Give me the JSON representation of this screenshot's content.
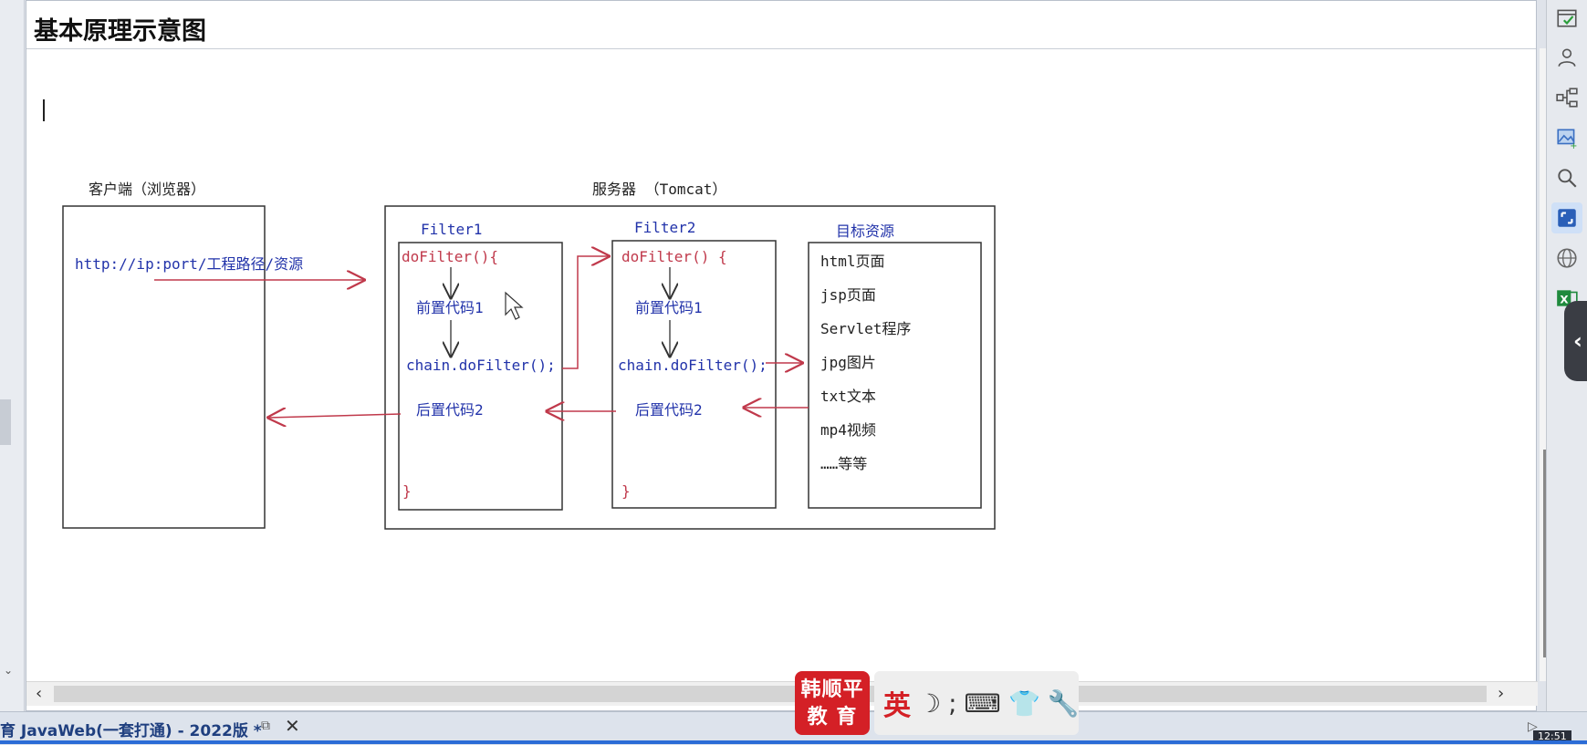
{
  "document": {
    "heading": "基本原理示意图"
  },
  "diagram": {
    "client": {
      "title": "客户端（浏览器）",
      "url": "http://ip:port/工程路径/资源"
    },
    "server": {
      "title": "服务器  （Tomcat）",
      "filter1": {
        "name": "Filter1",
        "open": "doFilter(){",
        "pre": "前置代码1",
        "chain": "chain.doFilter();",
        "post": "后置代码2",
        "close": "}"
      },
      "filter2": {
        "name": "Filter2",
        "open": "doFilter() {",
        "pre": "前置代码1",
        "chain": "chain.doFilter();",
        "post": "后置代码2",
        "close": "}"
      },
      "target": {
        "title": "目标资源",
        "items": [
          "html页面",
          "jsp页面",
          "Servlet程序",
          "jpg图片",
          "txt文本",
          "mp4视频",
          "……等等"
        ]
      }
    },
    "colors": {
      "arrow": "#c0394b",
      "blue_text": "#2233aa",
      "red_text": "#c0394b"
    }
  },
  "taskbar": {
    "tab_title": "育 JavaWeb(一套打通) - 2022版 *",
    "restore_icon": "⧉",
    "close_icon": "✕",
    "clock": "12:51"
  },
  "overlay": {
    "logo_line1": "韩顺平",
    "logo_line2": "教 育",
    "ime_lang": "英"
  }
}
